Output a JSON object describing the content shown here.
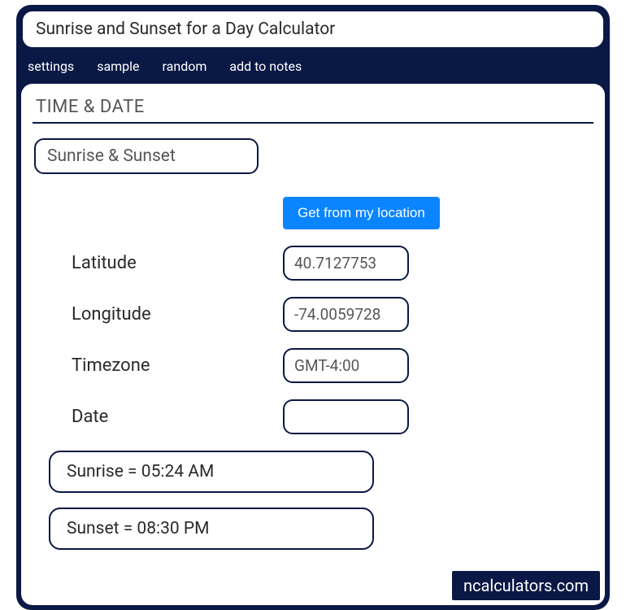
{
  "title": "Sunrise and Sunset for a Day Calculator",
  "toolbar": {
    "settings": "settings",
    "sample": "sample",
    "random": "random",
    "add_to_notes": "add to notes"
  },
  "section": {
    "header": "TIME & DATE",
    "subsection": "Sunrise & Sunset"
  },
  "location_button": "Get from my location",
  "fields": {
    "latitude": {
      "label": "Latitude",
      "value": "40.7127753"
    },
    "longitude": {
      "label": "Longitude",
      "value": "-74.0059728"
    },
    "timezone": {
      "label": "Timezone",
      "value": "GMT-4:00"
    },
    "date": {
      "label": "Date",
      "value": ""
    }
  },
  "results": {
    "sunrise": "Sunrise  =  05:24 AM",
    "sunset": "Sunset  =  08:30 PM"
  },
  "watermark": "ncalculators.com"
}
